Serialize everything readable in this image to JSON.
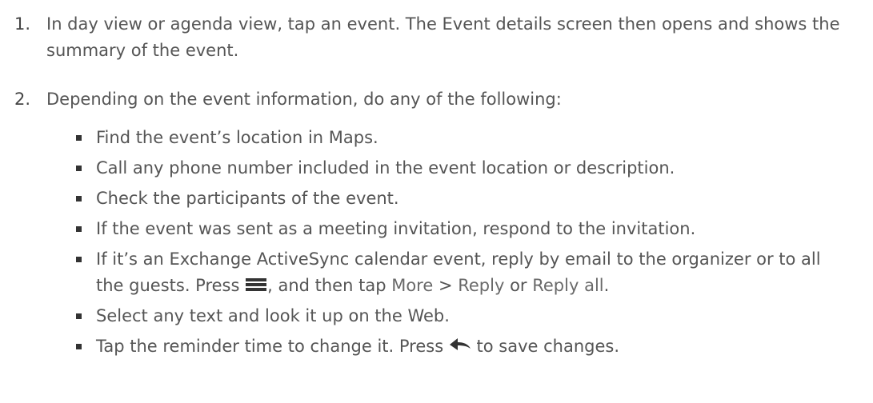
{
  "steps": [
    {
      "number": "1.",
      "text": "In day view or agenda view, tap an event. The Event details screen then opens and shows the summary of the event."
    },
    {
      "number": "2.",
      "text": "Depending on the event information, do any of the following:"
    }
  ],
  "bullets": {
    "b0": "Find the event’s location in Maps.",
    "b1": "Call any phone number included in the event location or description.",
    "b2": "Check the participants of the event.",
    "b3": "If the event was sent as a meeting invitation, respond to the invitation.",
    "b4": {
      "part1": "If it’s an Exchange ActiveSync calendar event, reply by email to the organizer or to all the guests. Press ",
      "part2": ", and then tap ",
      "more": "More",
      "sep": " > ",
      "reply": "Reply",
      "or": " or ",
      "reply_all": "Reply all",
      "end": "."
    },
    "b5": "Select any text and look it up on the Web.",
    "b6": {
      "part1": "Tap the reminder time to change it. Press ",
      "part2": " to save changes."
    }
  },
  "icons": {
    "menu": "menu-icon",
    "back": "back-arrow-icon"
  },
  "colors": {
    "text": "#555555",
    "icon": "#333333"
  }
}
